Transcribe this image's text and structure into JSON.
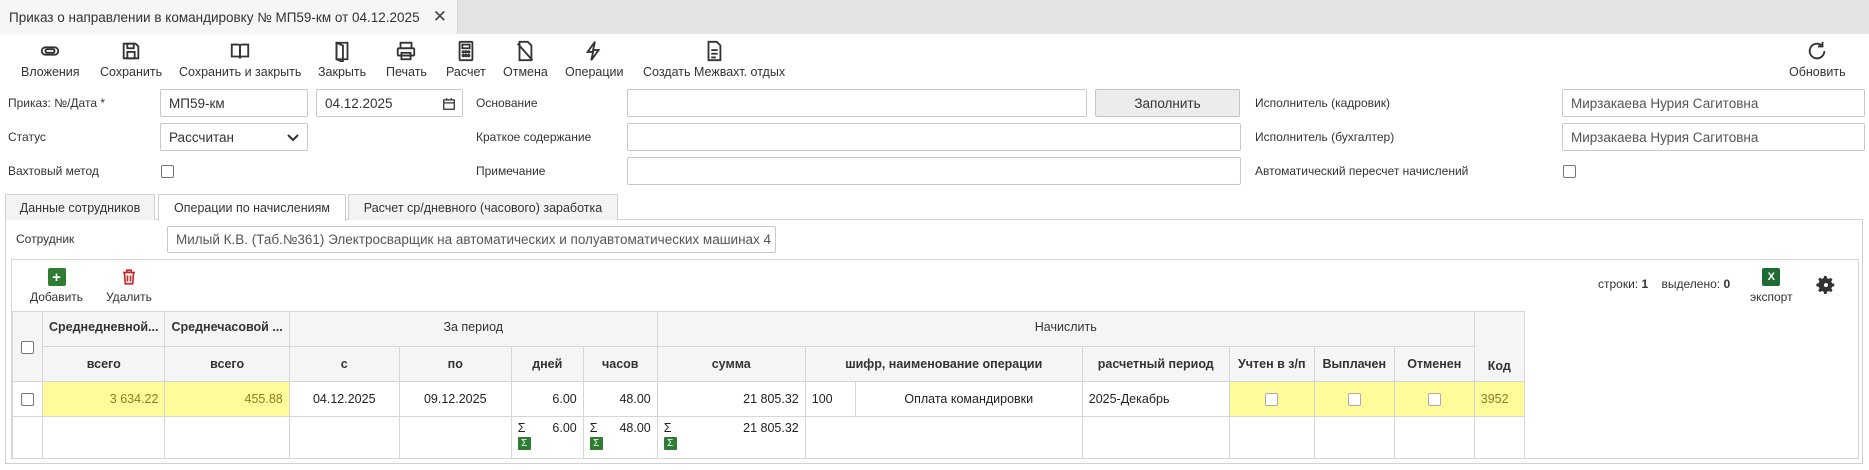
{
  "doc_tab": {
    "title": "Приказ о направлении в командировку № МП59-км от 04.12.2025",
    "close": "✕"
  },
  "toolbar": {
    "attachments": "Вложения",
    "save": "Сохранить",
    "save_close": "Сохранить и закрыть",
    "close": "Закрыть",
    "print": "Печать",
    "calc": "Расчет",
    "cancel": "Отмена",
    "operations": "Операции",
    "create_rest": "Создать Межвахт. отдых",
    "refresh": "Обновить"
  },
  "form": {
    "order_label": "Приказ: №/Дата *",
    "order_number": "МП59-км",
    "order_date": "04.12.2025",
    "status_label": "Статус",
    "status_value": "Рассчитан",
    "shift_label": "Вахтовый метод",
    "basis_label": "Основание",
    "basis_value": "",
    "fill_button": "Заполнить",
    "summary_label": "Краткое содержание",
    "summary_value": "",
    "note_label": "Примечание",
    "note_value": "",
    "executor_hr_label": "Исполнитель (кадровик)",
    "executor_hr_value": "Мирзакаева Нурия Сагитовна",
    "executor_acc_label": "Исполнитель (бухгалтер)",
    "executor_acc_value": "Мирзакаева Нурия Сагитовна",
    "auto_recalc_label": "Автоматический пересчет начислений"
  },
  "tabs": [
    "Данные сотрудников",
    "Операции по начислениям",
    "Расчет ср/дневного (часового) заработка"
  ],
  "employee": {
    "label": "Сотрудник",
    "value": "Милый К.В. (Таб.№361) Электросварщик на автоматических и полуавтоматических машинах 4"
  },
  "grid_toolbar": {
    "add": "Добавить",
    "delete": "Удалить",
    "rows_label": "строки:",
    "rows_count": "1",
    "selected_label": "выделено:",
    "selected_count": "0",
    "export": "экспорт",
    "excel_letter": "X"
  },
  "table": {
    "head": {
      "avg_day": "Среднедневной...",
      "avg_hour": "Среднечасовой ...",
      "period": "За период",
      "accrue": "Начислить",
      "total1": "всего",
      "total2": "всего",
      "from": "с",
      "to": "по",
      "days": "дней",
      "hours": "часов",
      "sum": "сумма",
      "op_code": "шифр, наименование операции",
      "calc_period": "расчетный период",
      "in_payroll": "Учтен в з/п",
      "paid": "Выплачен",
      "cancelled": "Отменен",
      "code": "Код"
    },
    "row": {
      "avg_day": "3 634.22",
      "avg_hour": "455.88",
      "from": "04.12.2025",
      "to": "09.12.2025",
      "days": "6.00",
      "hours": "48.00",
      "sum": "21 805.32",
      "op_code": "100",
      "op_name": "Оплата командировки",
      "calc_period": "2025-Декабрь",
      "code": "3952"
    },
    "totals": {
      "sigma": "Σ",
      "days": "6.00",
      "hours": "48.00",
      "sum": "21 805.32"
    }
  }
}
